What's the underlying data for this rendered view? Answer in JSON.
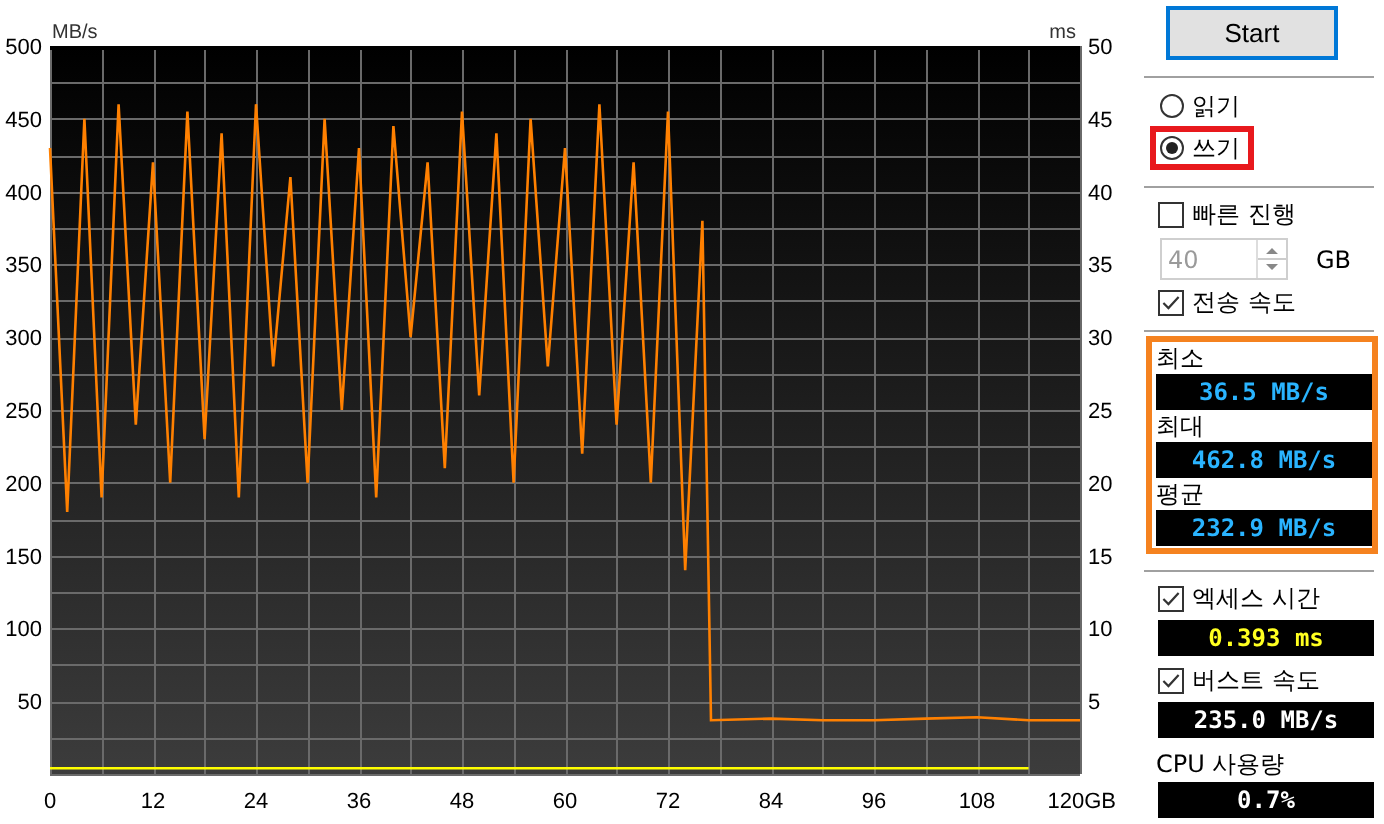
{
  "chart": {
    "chart_data": {
      "type": "line",
      "ylabel": "MB/s",
      "x": [
        0,
        2,
        4,
        6,
        8,
        10,
        12,
        14,
        16,
        18,
        20,
        22,
        24,
        26,
        28,
        30,
        32,
        34,
        36,
        38,
        40,
        42,
        44,
        46,
        48,
        50,
        52,
        54,
        56,
        58,
        60,
        62,
        64,
        66,
        68,
        70,
        72,
        74,
        76,
        77,
        84,
        90,
        96,
        102,
        108,
        114,
        120
      ],
      "series": [
        {
          "color": "#ff8000",
          "values": [
            430,
            180,
            450,
            190,
            460,
            240,
            420,
            200,
            455,
            230,
            440,
            190,
            460,
            280,
            410,
            200,
            450,
            250,
            430,
            190,
            445,
            300,
            420,
            210,
            455,
            260,
            440,
            200,
            450,
            280,
            430,
            220,
            460,
            240,
            420,
            200,
            455,
            140,
            380,
            37,
            38,
            37,
            37,
            38,
            39,
            37,
            37
          ]
        },
        {
          "color": "#ffff00",
          "values": [
            4,
            4,
            4,
            4,
            4,
            4,
            4,
            4,
            4,
            4,
            4,
            4,
            4,
            4,
            4,
            4,
            4,
            4,
            4,
            4,
            4,
            4,
            4,
            4,
            4,
            4,
            4,
            4,
            4,
            4,
            4,
            4,
            4,
            4,
            4,
            4,
            4,
            4,
            4,
            4,
            4,
            4,
            4,
            4,
            4,
            4,
            null
          ]
        }
      ],
      "xlim": [
        0,
        120
      ],
      "ylim": [
        0,
        500
      ],
      "xticks": [
        0,
        12,
        24,
        36,
        48,
        60,
        72,
        84,
        96,
        108,
        {
          "value": 120,
          "label": "120GB"
        }
      ],
      "yticks": [
        50,
        100,
        150,
        200,
        250,
        300,
        350,
        400,
        450,
        500
      ],
      "grid": true
    },
    "right_axis": {
      "unit": "ms",
      "ticks": [
        "50",
        "45",
        "40",
        "35",
        "30",
        "25",
        "20",
        "15",
        "10",
        "5"
      ]
    }
  },
  "panel": {
    "start_button": "Start",
    "mode_options": [
      {
        "label": "읽기",
        "selected": false
      },
      {
        "label": "쓰기",
        "selected": true
      }
    ],
    "quick_scan": {
      "label": "빠른 진행",
      "checked": false
    },
    "size_field": {
      "value": "40",
      "disabled": true,
      "unit": "GB"
    },
    "transfer_rate": {
      "label": "전송 속도",
      "checked": true,
      "stats": [
        {
          "label": "최소",
          "value": "36.5 MB/s"
        },
        {
          "label": "최대",
          "value": "462.8 MB/s"
        },
        {
          "label": "평균",
          "value": "232.9 MB/s"
        }
      ]
    },
    "access_time": {
      "label": "엑세스 시간",
      "checked": true,
      "value": "0.393 ms"
    },
    "burst_rate": {
      "label": "버스트 속도",
      "checked": true,
      "value": "235.0 MB/s"
    },
    "cpu": {
      "label": "CPU 사용량",
      "value": "0.7%"
    }
  }
}
